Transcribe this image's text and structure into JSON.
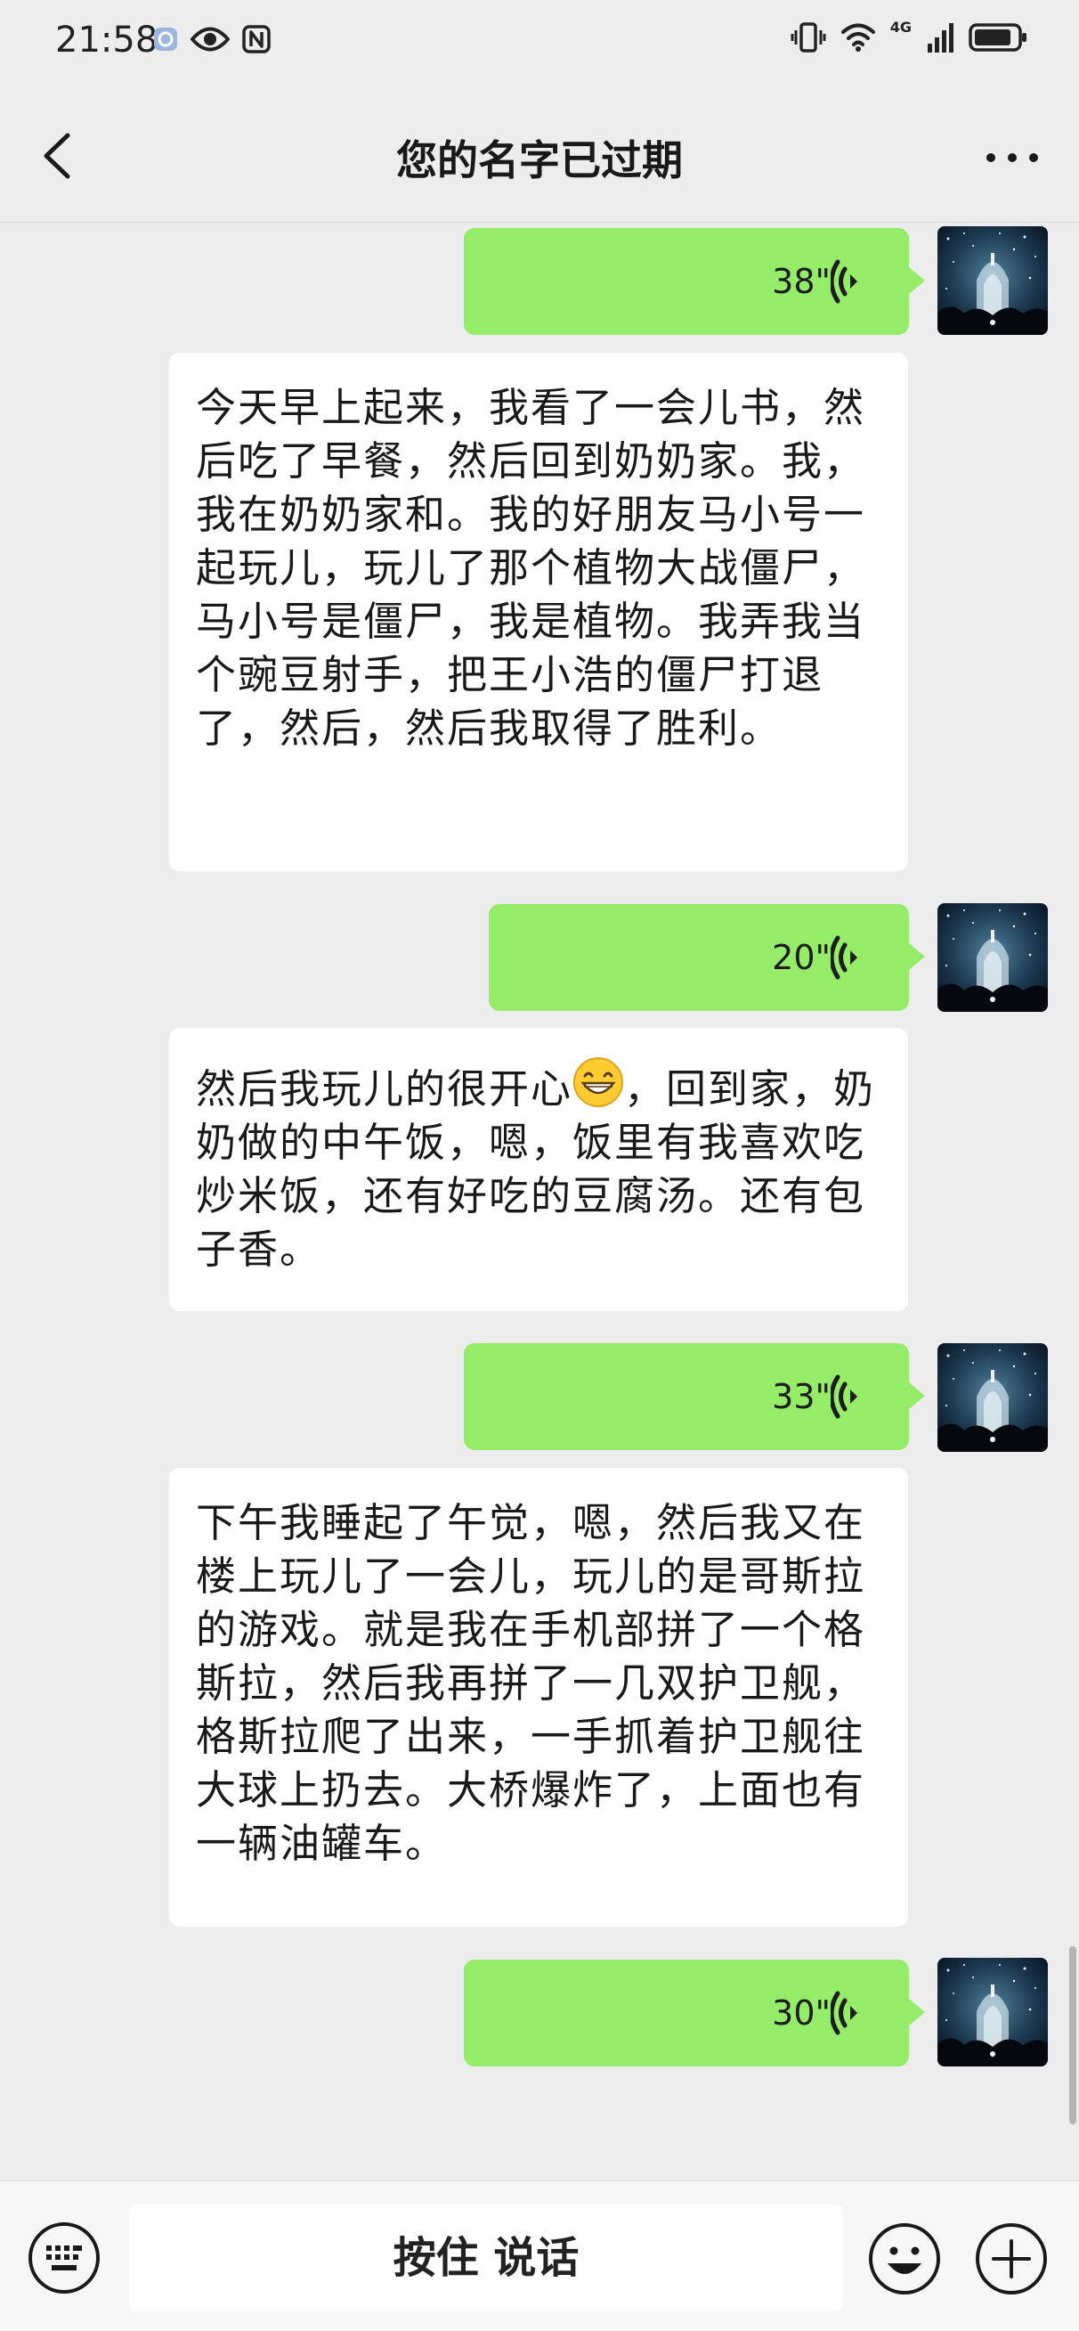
{
  "status_bar": {
    "time": "21:58",
    "network": "4G",
    "left_icons": [
      "notification-icon",
      "eye-icon",
      "nfc-icon"
    ],
    "right_icons": [
      "vibrate-icon",
      "wifi-icon",
      "signal-icon",
      "battery-icon"
    ]
  },
  "header": {
    "title": "您的名字已过期",
    "back_icon": "chevron-left-icon",
    "more_icon": "more-dots-icon"
  },
  "messages": [
    {
      "type": "voice",
      "sender": "me",
      "duration": "38\""
    },
    {
      "type": "text",
      "sender": "other",
      "text": "今天早上起来，我看了一会儿书，然后吃了早餐，然后回到奶奶家。我，我在奶奶家和。我的好朋友马小号一起玩儿，玩儿了那个植物大战僵尸，马小号是僵尸，我是植物。我弄我当个豌豆射手，把王小浩的僵尸打退了，然后，然后我取得了胜利。"
    },
    {
      "type": "voice",
      "sender": "me",
      "duration": "20\""
    },
    {
      "type": "text",
      "sender": "other",
      "text_before_emoji": "然后我玩儿的很开心",
      "emoji": "grinning-face-emoji",
      "text_after_emoji": "，回到家，奶奶做的中午饭，嗯，饭里有我喜欢吃炒米饭，还有好吃的豆腐汤。还有包子香。"
    },
    {
      "type": "voice",
      "sender": "me",
      "duration": "33\""
    },
    {
      "type": "text",
      "sender": "other",
      "text": "下午我睡起了午觉，嗯，然后我又在楼上玩儿了一会儿，玩儿的是哥斯拉的游戏。就是我在手机部拼了一个格斯拉，然后我再拼了一几双护卫舰，格斯拉爬了出来，一手抓着护卫舰往大球上扔去。大桥爆炸了，上面也有一辆油罐车。"
    },
    {
      "type": "voice",
      "sender": "me",
      "duration": "30\""
    }
  ],
  "input_bar": {
    "hold_to_talk": "按住 说话",
    "keyboard_icon": "keyboard-icon",
    "emoji_icon": "smiley-icon",
    "plus_icon": "plus-circle-icon"
  },
  "colors": {
    "background": "#ededed",
    "my_bubble": "#95ec69",
    "other_bubble": "#ffffff",
    "input_bar": "#f7f7f7"
  }
}
